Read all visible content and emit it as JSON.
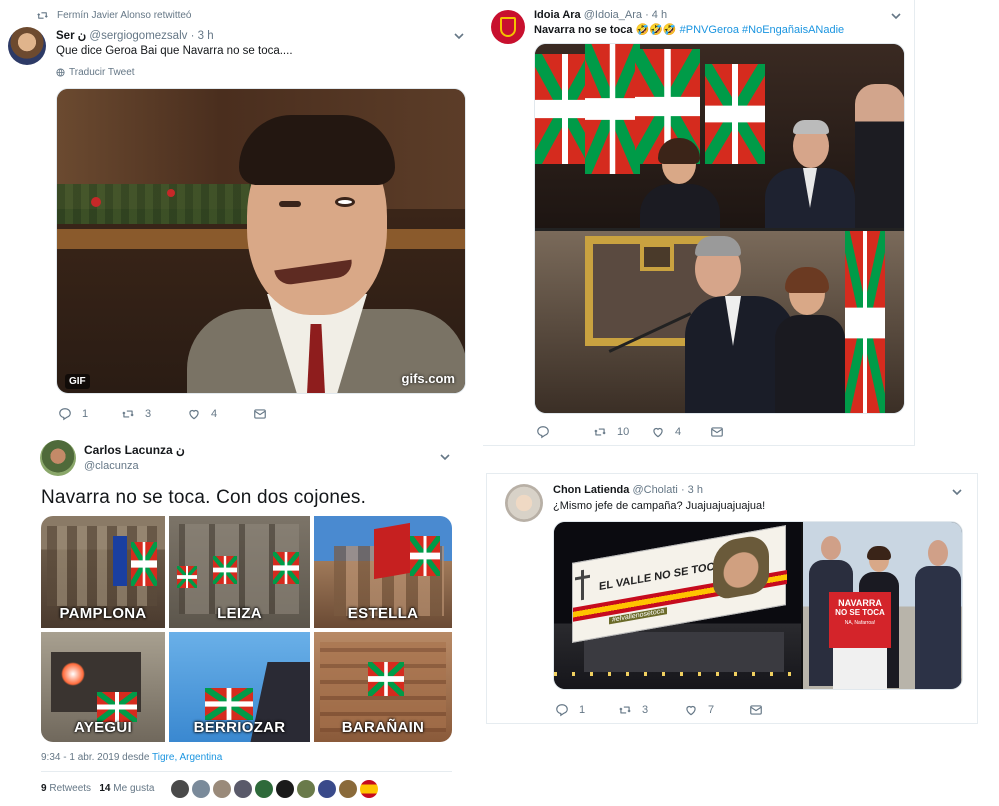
{
  "tweet1": {
    "retweet_note": "Fermín Javier Alonso retwitteó",
    "name": "Ser",
    "name_glyph": "ن",
    "handle": "@sergiogomezsalv",
    "time": "· 3 h",
    "text": "Que dice Geroa Bai que Navarra no se toca....",
    "translate": "Traducir Tweet",
    "gif_badge": "GIF",
    "gif_watermark": "gifs.com",
    "replies": "1",
    "retweets": "3",
    "likes": "4"
  },
  "tweet2": {
    "name": "Idoia Ara",
    "handle": "@Idoia_Ara",
    "time": "· 4 h",
    "text_bold": "Navarra no se toca",
    "emoji": "🤣🤣🤣",
    "hashtags": "#PNVGeroa #NoEngañaisANadie",
    "replies": "",
    "retweets": "10",
    "likes": "4"
  },
  "tweet3": {
    "name": "Carlos Lacunza",
    "name_glyph": "ن",
    "handle": "@clacunza",
    "text": "Navarra no se toca. Con dos cojones.",
    "tiles": [
      {
        "label": "PAMPLONA"
      },
      {
        "label": "LEIZA"
      },
      {
        "label": "ESTELLA"
      },
      {
        "label": "AYEGUI"
      },
      {
        "label": "BERRIOZAR"
      },
      {
        "label": "BARAÑAIN"
      }
    ],
    "timestamp": "9:34 - 1 abr. 2019 desde",
    "location": "Tigre, Argentina",
    "retweets_count": "9",
    "retweets_label": "Retweets",
    "likes_count": "14",
    "likes_label": "Me gusta"
  },
  "tweet4": {
    "name": "Chon Latienda",
    "handle": "@Cholati",
    "time": "· 3 h",
    "text": "¿Mismo jefe de campaña? Juajuajuajuajua!",
    "banner_text": "EL VALLE NO SE TOCA",
    "banner_tag": "#elvallenosetoca",
    "sign_line1": "NAVARRA",
    "sign_line2": "NO SE TOCA",
    "sign_sub": "NA, Nafarroa!",
    "replies": "1",
    "retweets": "3",
    "likes": "7"
  },
  "colors": {
    "accent": "#1b95e0",
    "muted": "#657786",
    "ikurrina_red": "#d52b1e",
    "ikurrina_green": "#009b48"
  }
}
